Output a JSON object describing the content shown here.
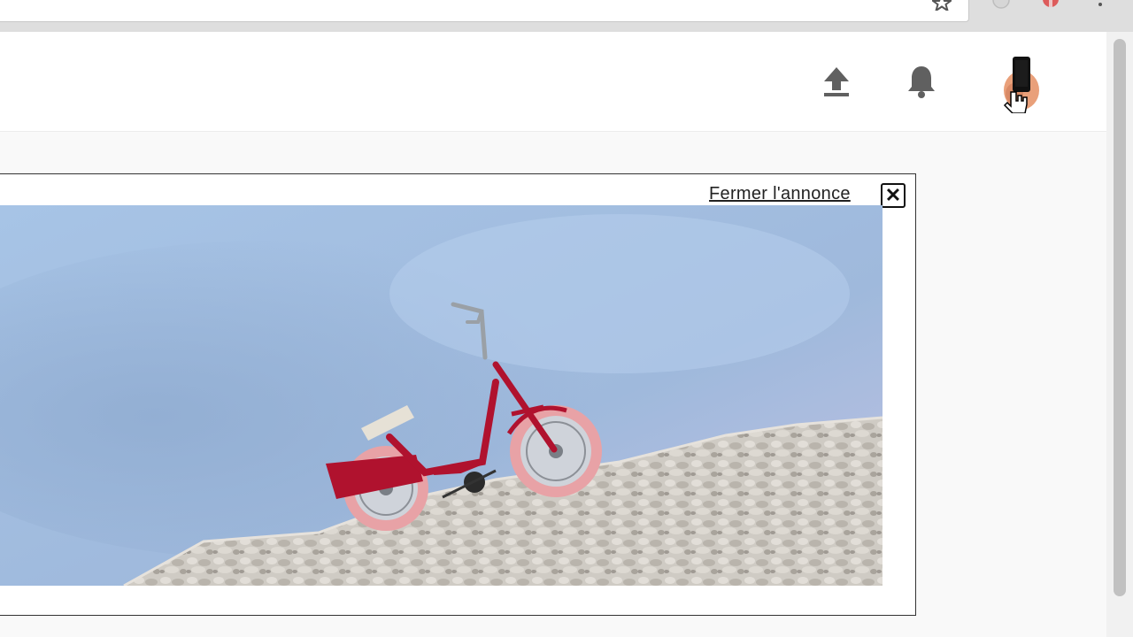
{
  "browser": {
    "icons": [
      "star-icon",
      "extension-icon",
      "extension-icon",
      "menu-icon"
    ]
  },
  "header": {
    "icons": [
      "upload-icon",
      "bell-icon",
      "avatar"
    ]
  },
  "ad": {
    "close_label": "Fermer l'annonce",
    "close_symbol": "✕"
  },
  "colors": {
    "sky_top": "#a9c6e8",
    "sky_bottom": "#b8bfe0",
    "tricycle": "#b0122e",
    "tire": "#e7a3a7",
    "rocks": "#cfccc6"
  }
}
